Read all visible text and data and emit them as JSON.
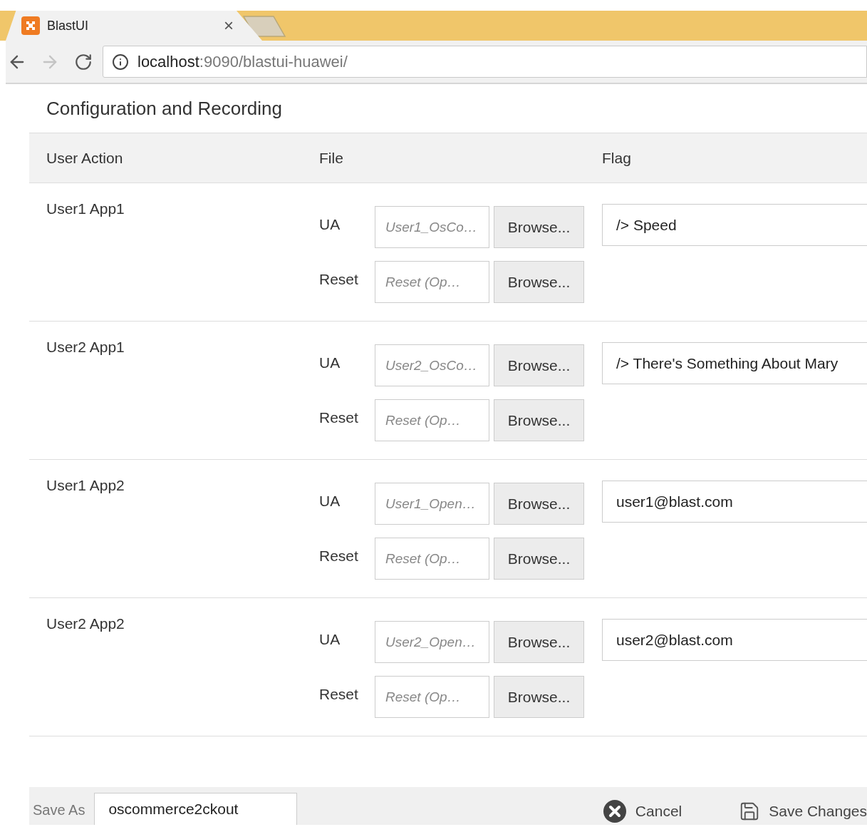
{
  "browser": {
    "tab": {
      "title": "BlastUI",
      "close": "×"
    },
    "address": {
      "host": "localhost",
      "path": ":9090/blastui-huawei/"
    }
  },
  "page": {
    "title": "Configuration and Recording"
  },
  "table": {
    "columns": [
      "User Action",
      "File",
      "Flag"
    ],
    "rows": [
      {
        "user_action": "User1 App1",
        "files": [
          {
            "label": "UA",
            "placeholder": "User1_OsCo…",
            "button": "Browse..."
          },
          {
            "label": "Reset",
            "placeholder": "Reset (Op…",
            "button": "Browse..."
          }
        ],
        "flag": "/> Speed"
      },
      {
        "user_action": "User2 App1",
        "files": [
          {
            "label": "UA",
            "placeholder": "User2_OsCo…",
            "button": "Browse..."
          },
          {
            "label": "Reset",
            "placeholder": "Reset (Op…",
            "button": "Browse..."
          }
        ],
        "flag": "/> There's Something About Mary"
      },
      {
        "user_action": "User1 App2",
        "files": [
          {
            "label": "UA",
            "placeholder": "User1_Open…",
            "button": "Browse..."
          },
          {
            "label": "Reset",
            "placeholder": "Reset (Op…",
            "button": "Browse..."
          }
        ],
        "flag": "user1@blast.com"
      },
      {
        "user_action": "User2 App2",
        "files": [
          {
            "label": "UA",
            "placeholder": "User2_Open…",
            "button": "Browse..."
          },
          {
            "label": "Reset",
            "placeholder": "Reset (Op…",
            "button": "Browse..."
          }
        ],
        "flag": "user2@blast.com"
      }
    ]
  },
  "footer": {
    "save_as_label": "Save As",
    "save_as_value": "oscommerce2ckout",
    "buttons": [
      {
        "label": "Cancel",
        "kind": "cancel"
      },
      {
        "label": "Save Changes",
        "kind": "save"
      }
    ]
  }
}
